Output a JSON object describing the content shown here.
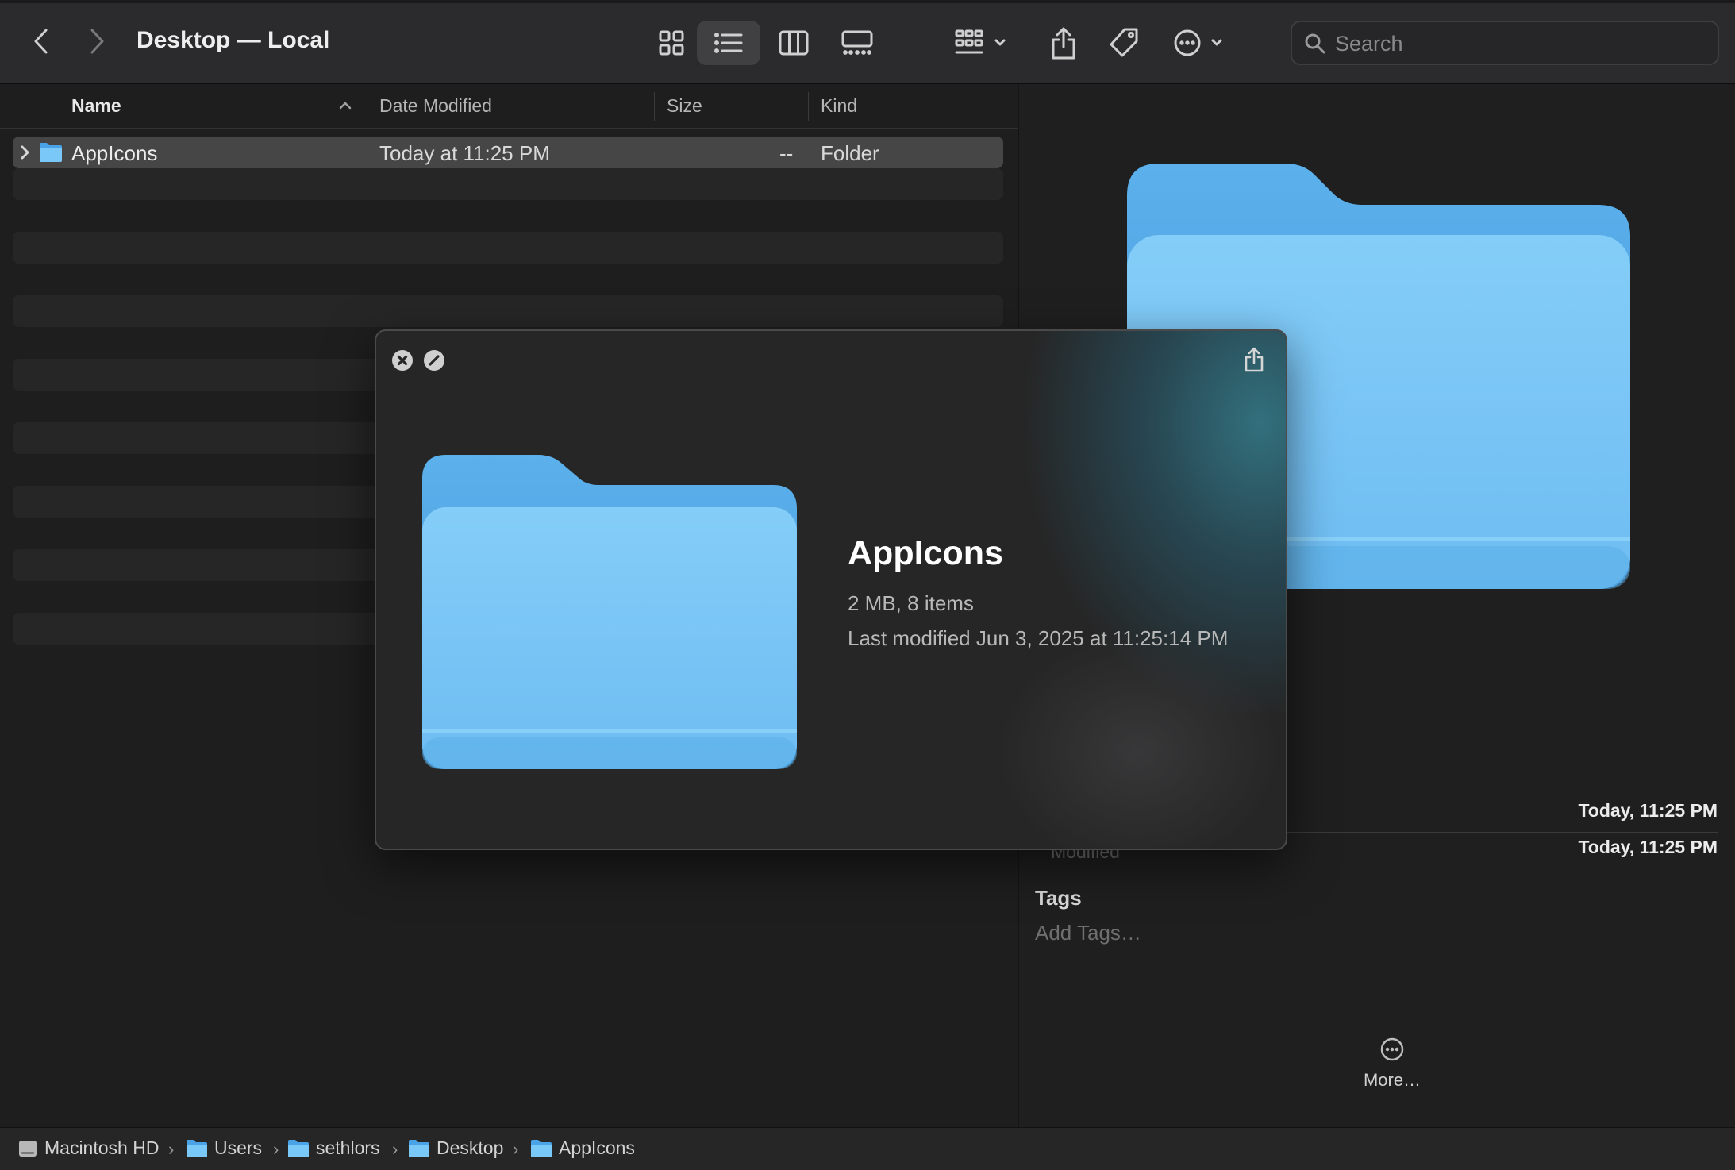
{
  "window": {
    "title": "Desktop — Local"
  },
  "search": {
    "placeholder": "Search"
  },
  "columns": {
    "name": "Name",
    "date": "Date Modified",
    "size": "Size",
    "kind": "Kind"
  },
  "files": [
    {
      "name": "AppIcons",
      "date": "Today at 11:25 PM",
      "size": "--",
      "kind": "Folder"
    }
  ],
  "preview": {
    "created_value": "Today, 11:25 PM",
    "modified_label": "Modified",
    "modified_value": "Today, 11:25 PM",
    "tags_title": "Tags",
    "tags_placeholder": "Add Tags…",
    "more_label": "More…"
  },
  "quicklook": {
    "title": "AppIcons",
    "info": "2 MB, 8 items",
    "modified": "Last modified Jun 3, 2025 at 11:25:14 PM"
  },
  "path": [
    "Macintosh HD",
    "Users",
    "sethlors",
    "Desktop",
    "AppIcons"
  ],
  "colors": {
    "folder_light": "#79c8f7",
    "folder_dark": "#4aa3e6",
    "accent_glow": "#2f6f80"
  },
  "icons": [
    "chevron-left-icon",
    "chevron-right-icon",
    "icon-view-icon",
    "list-view-icon",
    "column-view-icon",
    "gallery-view-icon",
    "group-icon",
    "share-icon",
    "tag-icon",
    "ellipsis-circle-icon",
    "search-icon",
    "folder-icon",
    "close-icon",
    "fullscreen-icon",
    "hard-drive-icon"
  ]
}
